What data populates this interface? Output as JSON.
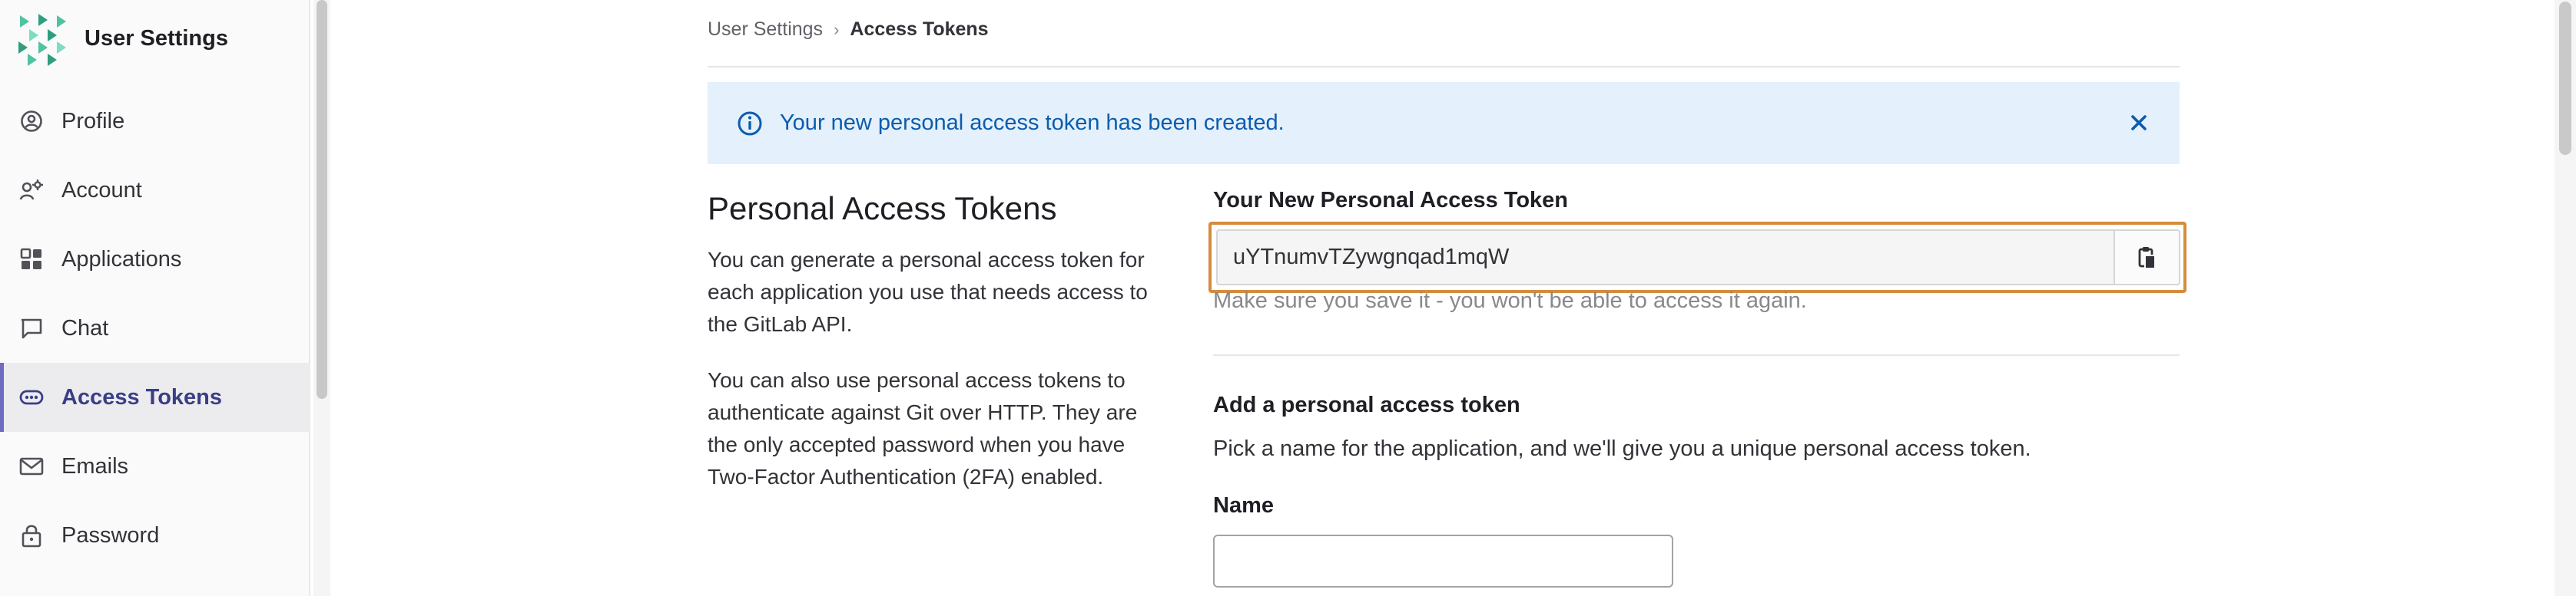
{
  "app": {
    "title": "User Settings",
    "logo_icon": "tanuki-logo-icon"
  },
  "sidebar": {
    "items": [
      {
        "label": "Profile",
        "icon": "profile-icon",
        "active": false
      },
      {
        "label": "Account",
        "icon": "account-icon",
        "active": false
      },
      {
        "label": "Applications",
        "icon": "applications-icon",
        "active": false
      },
      {
        "label": "Chat",
        "icon": "chat-icon",
        "active": false
      },
      {
        "label": "Access Tokens",
        "icon": "token-icon",
        "active": true
      },
      {
        "label": "Emails",
        "icon": "email-icon",
        "active": false
      },
      {
        "label": "Password",
        "icon": "lock-icon",
        "active": false
      }
    ]
  },
  "breadcrumb": {
    "parent": "User Settings",
    "separator": "›",
    "current": "Access Tokens"
  },
  "alert": {
    "text": "Your new personal access token has been created.",
    "icon": "info-icon",
    "close_icon": "close-icon"
  },
  "section": {
    "title": "Personal Access Tokens",
    "paragraphs": [
      "You can generate a personal access token for each application you use that needs access to the GitLab API.",
      "You can also use personal access tokens to authenticate against Git over HTTP. They are the only accepted password when you have Two-Factor Authentication (2FA) enabled."
    ]
  },
  "new_token": {
    "label": "Your New Personal Access Token",
    "value": "uYTnumvTZywgnqad1mqW",
    "hint": "Make sure you save it - you won't be able to access it again.",
    "copy_icon": "clipboard-icon"
  },
  "add_token": {
    "title": "Add a personal access token",
    "description": "Pick a name for the application, and we'll give you a unique personal access token.",
    "name_label": "Name",
    "name_value": ""
  },
  "colors": {
    "active_border": "#6e6bc0",
    "alert_bg": "#e4f0fb",
    "alert_text": "#0b5cad",
    "highlight": "#d58c3c"
  }
}
